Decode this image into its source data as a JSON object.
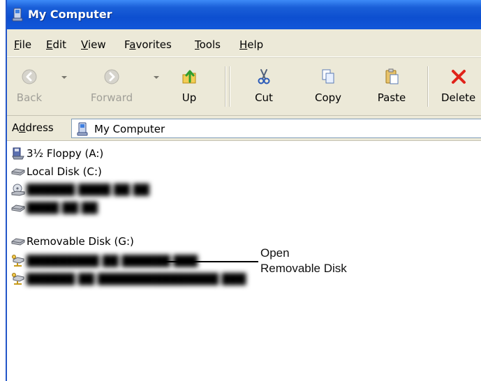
{
  "window": {
    "title": "My Computer",
    "title_icon": "my-computer-icon"
  },
  "menu": {
    "items": [
      {
        "accel": "F",
        "rest": "ile"
      },
      {
        "accel": "E",
        "rest": "dit"
      },
      {
        "accel": "V",
        "rest": "iew"
      },
      {
        "pre": "F",
        "accel": "a",
        "rest": "vorites"
      },
      {
        "accel": "T",
        "rest": "ools"
      },
      {
        "accel": "H",
        "rest": "elp"
      }
    ]
  },
  "toolbar": {
    "back": {
      "label": "Back",
      "icon": "back-arrow-icon",
      "enabled": false
    },
    "forward": {
      "label": "Forward",
      "icon": "forward-arrow-icon",
      "enabled": false
    },
    "up": {
      "label": "Up",
      "icon": "up-folder-icon",
      "enabled": true
    },
    "cut": {
      "label": "Cut",
      "icon": "scissors-icon",
      "enabled": true
    },
    "copy": {
      "label": "Copy",
      "icon": "copy-icon",
      "enabled": true
    },
    "paste": {
      "label": "Paste",
      "icon": "paste-icon",
      "enabled": true
    },
    "delete": {
      "label": "Delete",
      "icon": "delete-x-icon",
      "enabled": true
    }
  },
  "address": {
    "label_pre": "A",
    "label_accel": "d",
    "label_rest": "dress",
    "value": "My Computer",
    "icon": "my-computer-icon"
  },
  "drives": [
    {
      "label": "3½ Floppy (A:)",
      "icon": "floppy-drive-icon",
      "blurred": false
    },
    {
      "label": "Local Disk (C:)",
      "icon": "hard-disk-icon",
      "blurred": false
    },
    {
      "label": "",
      "icon": "cd-drive-icon",
      "blurred": true
    },
    {
      "label": "",
      "icon": "hard-disk-icon",
      "blurred": true
    },
    {
      "label": "Removable Disk (G:)",
      "icon": "removable-disk-icon",
      "blurred": false
    },
    {
      "label": "",
      "icon": "network-drive-icon",
      "blurred": true
    },
    {
      "label": "",
      "icon": "network-drive-icon",
      "blurred": true
    }
  ],
  "callout": {
    "line1": "Open",
    "line2": "Removable Disk"
  },
  "colors": {
    "titlebar": "#0d4fd0",
    "chrome": "#ece9d8",
    "delete_red": "#e0231a"
  }
}
